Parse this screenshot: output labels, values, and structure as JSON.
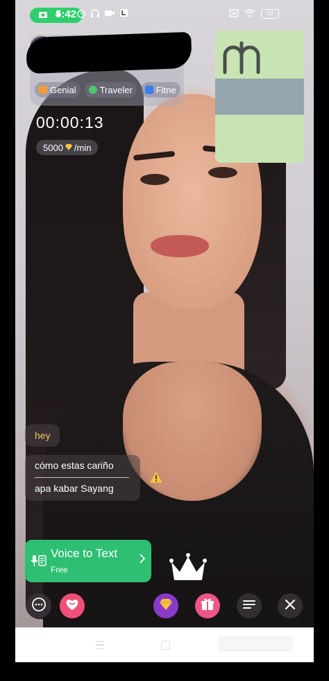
{
  "status_bar": {
    "time": "5:42",
    "battery": "32"
  },
  "profile": {
    "tags": [
      "Genial",
      "Traveler",
      "Fitne"
    ],
    "call_timer": "00:00:13",
    "rate_amount": "5000",
    "rate_unit": "/min"
  },
  "preview": {
    "glyph_icon": "currency-glyph-icon"
  },
  "chat": {
    "messages": [
      {
        "text": "hey"
      },
      {
        "original": "cómo estas cariño",
        "translation": "apa kabar Sayang"
      }
    ]
  },
  "voice_to_text": {
    "title": "Voice to Text",
    "subtitle": "Free"
  },
  "colors": {
    "accent_green": "#2fbf73",
    "heart_pink": "#f05078",
    "gem_purple": "#8a3ac9",
    "gift_pink": "#f0558a",
    "preview_green": "#c9e4b4",
    "preview_gray": "#95a5ad",
    "hey_yellow": "#f6c35a"
  }
}
